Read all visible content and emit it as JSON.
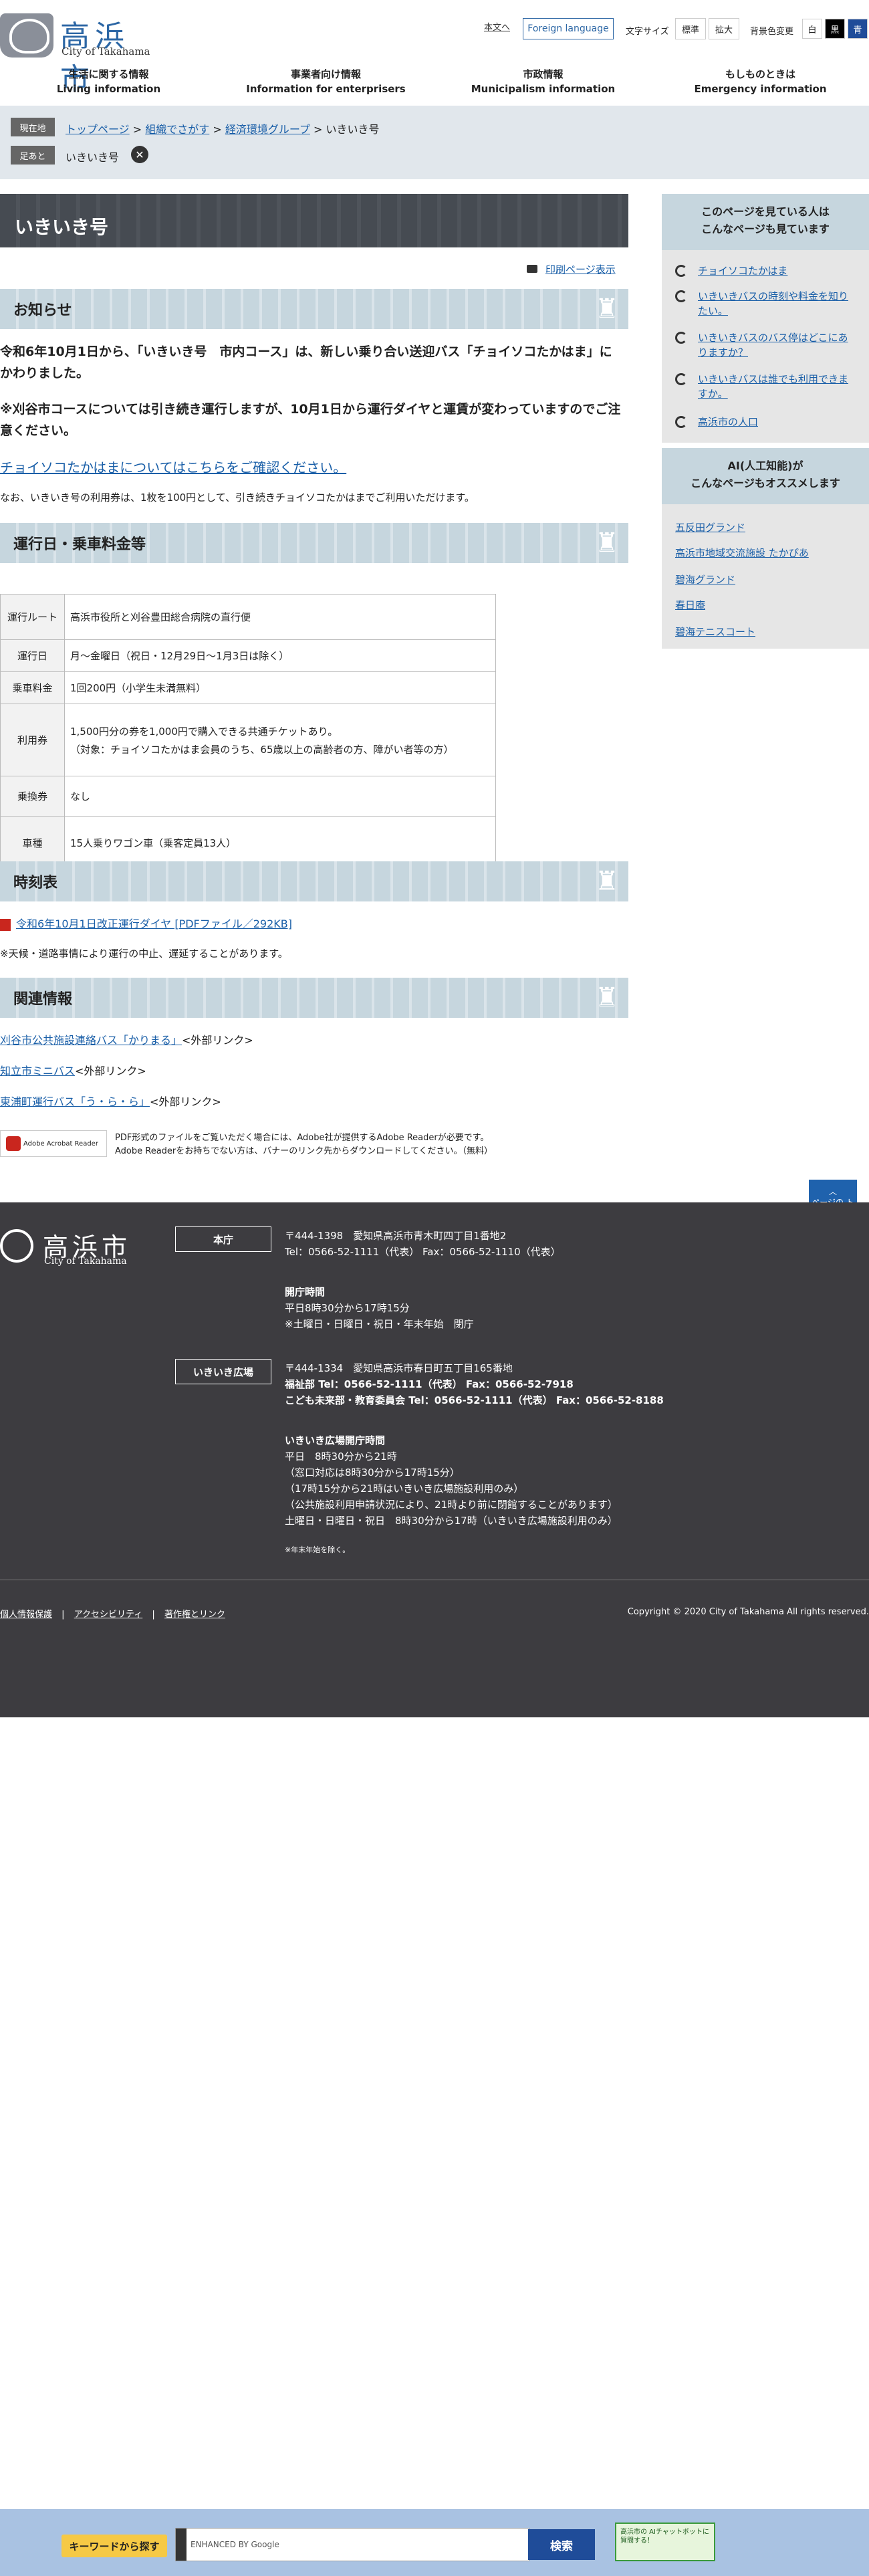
{
  "header": {
    "logo_jp": "高浜市",
    "logo_en": "City of Takahama",
    "honbun": "本文へ",
    "foreign": "Foreign language",
    "font_size_label": "文字サイズ",
    "font_std": "標準",
    "font_large": "拡大",
    "bg_label": "背景色変更",
    "bg_white": "白",
    "bg_black": "黒",
    "bg_blue": "青",
    "nav": [
      {
        "jp": "生活に関する情報",
        "en": "Living information"
      },
      {
        "jp": "事業者向け情報",
        "en": "Information for enterprisers"
      },
      {
        "jp": "市政情報",
        "en": "Municipalism information"
      },
      {
        "jp": "もしものときは",
        "en": "Emergency information"
      }
    ]
  },
  "breadcrumb": {
    "current_label": "現在地",
    "top": "トップページ",
    "org": "組織でさがす",
    "group": "経済環境グループ",
    "page": "いきいき号",
    "footprint_label": "足あと",
    "footprint_item": "いきいき号",
    "footprint_clear": "✕"
  },
  "main": {
    "title": "いきいき号",
    "print": "印刷ページ表示",
    "notice_heading": "お知らせ",
    "notice_p1": "令和6年10月1日から、「いきいき号　市内コース」は、新しい乗り合い送迎バス「チョイソコたかはま」に かわりました。",
    "notice_p2": "※刈谷市コースについては引き続き運行しますが、10月1日から運行ダイヤと運賃が変わっていますのでご注意ください。",
    "notice_link": "チョイソコたかはまについてはこちらをご確認ください。",
    "notice_p3": "なお、いきいき号の利用券は、1枚を100円として、引き続きチョイソコたかはまでご利用いただけます。",
    "fare_heading": "運行日・乗車料金等",
    "table": [
      {
        "h": "運行ルート",
        "v": "高浜市役所と刈谷豊田総合病院の直行便"
      },
      {
        "h": "運行日",
        "v": "月～金曜日（祝日・12月29日～1月3日は除く）"
      },
      {
        "h": "乗車料金",
        "v": "1回200円（小学生未満無料）"
      },
      {
        "h": "利用券",
        "v": "1,500円分の券を1,000円で購入できる共通チケットあり。",
        "v2": "（対象：チョイソコたかはま会員のうち、65歳以上の高齢者の方、障がい者等の方）"
      },
      {
        "h": "乗換券",
        "v": "なし"
      },
      {
        "h": "車種",
        "v": "15人乗りワゴン車（乗客定員13人）"
      }
    ],
    "timetable_heading": "時刻表",
    "timetable_link": "令和6年10月1日改正運行ダイヤ [PDFファイル／292KB]",
    "timetable_note": "※天候・道路事情により運行の中止、遅延することがあります。",
    "related_heading": "関連情報",
    "related": [
      {
        "link": "刈谷市公共施設連絡バス「かりまる」",
        "suffix": "<外部リンク>"
      },
      {
        "link": "知立市ミニバス",
        "suffix": "<外部リンク>"
      },
      {
        "link": "東浦町運行バス「う・ら・ら」",
        "suffix": "<外部リンク>"
      }
    ],
    "adobe_badge": "Adobe Acrobat Reader",
    "adobe_text1": "PDF形式のファイルをご覧いただく場合には、Adobe社が提供するAdobe Readerが必要です。",
    "adobe_text2": "Adobe Readerをお持ちでない方は、バナーのリンク先からダウンロードしてください。（無料）",
    "page_top": "ページの トップへ"
  },
  "sidebar": {
    "viewing_heading1": "このページを見ている人は",
    "viewing_heading2": "こんなページも見ています",
    "viewing": [
      "チョイソコたかはま",
      "いきいきバスの時刻や料金を知りたい。",
      "いきいきバスのバス停はどこにありますか？",
      "いきいきバスは誰でも利用できますか。",
      "高浜市の人口"
    ],
    "ai_heading1": "AI(人工知能)が",
    "ai_heading2": "こんなページもオススメします",
    "ai": [
      "五反田グランド",
      "高浜市地域交流施設 たかぴあ",
      "碧海グランド",
      "春日庵",
      "碧海テニスコート"
    ]
  },
  "footer": {
    "logo_jp": "高浜市",
    "logo_en": "City of Takahama",
    "honcho_tag": "本庁",
    "honcho_addr": "〒444-1398　愛知県高浜市青木町四丁目1番地2",
    "honcho_tel": "Tel：0566-52-1111（代表）  Fax：0566-52-1110（代表）",
    "hours_title": "開庁時間",
    "hours1": "平日8時30分から17時15分",
    "hours2": "※土曜日・日曜日・祝日・年末年始　閉庁",
    "hiroba_tag": "いきいき広場",
    "hiroba_addr": "〒444-1334　愛知県高浜市春日町五丁目165番地",
    "fukushi": "福祉部 Tel：0566-52-1111（代表）  Fax：0566-52-7918",
    "kodomo": "こども未来部・教育委員会 Tel：0566-52-1111（代表）  Fax：0566-52-8188",
    "hiroba_hours_title": "いきいき広場開庁時間",
    "hh1": "平日　8時30分から21時",
    "hh2": "（窓口対応は8時30分から17時15分）",
    "hh3": "（17時15分から21時はいきいき広場施設利用のみ）",
    "hh4": "（公共施設利用申請状況により、21時より前に閉館することがあります）",
    "hh5": "土曜日・日曜日・祝日　8時30分から17時（いきいき広場施設利用のみ）",
    "note": "※年末年始を除く。",
    "link1": "個人情報保護",
    "link2": "アクセシビリティ",
    "link3": "著作権とリンク",
    "copyright": "Copyright © 2020 City of Takahama All rights reserved."
  },
  "search": {
    "keyword_btn": "キーワードから探す",
    "placeholder": "ENHANCED BY Google",
    "submit": "検索",
    "ai_banner": "高浜市の AIチャットボットに 質問する！"
  }
}
